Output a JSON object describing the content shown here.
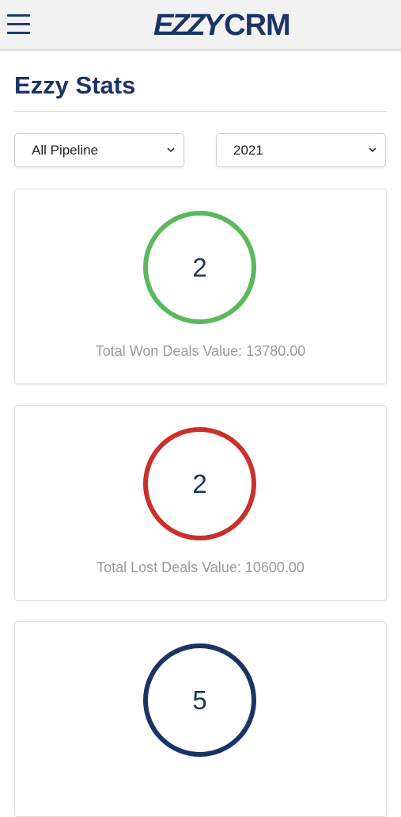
{
  "header": {
    "logo_left": "EZZY",
    "logo_right": "CRM"
  },
  "page": {
    "title": "Ezzy Stats"
  },
  "filters": {
    "pipeline": "All Pipeline",
    "year": "2021"
  },
  "cards": [
    {
      "count": "2",
      "caption": "Total Won Deals Value: 13780.00",
      "color": "#5cb85c"
    },
    {
      "count": "2",
      "caption": "Total Lost Deals Value: 10600.00",
      "color": "#c9302c"
    },
    {
      "count": "5",
      "caption": "",
      "color": "#1b3464"
    }
  ],
  "colors": {
    "brand": "#1b3464",
    "won": "#5cb85c",
    "lost": "#c9302c"
  },
  "icons": {
    "menu": "hamburger-menu-icon",
    "dropdown": "chevron-down-icon"
  }
}
